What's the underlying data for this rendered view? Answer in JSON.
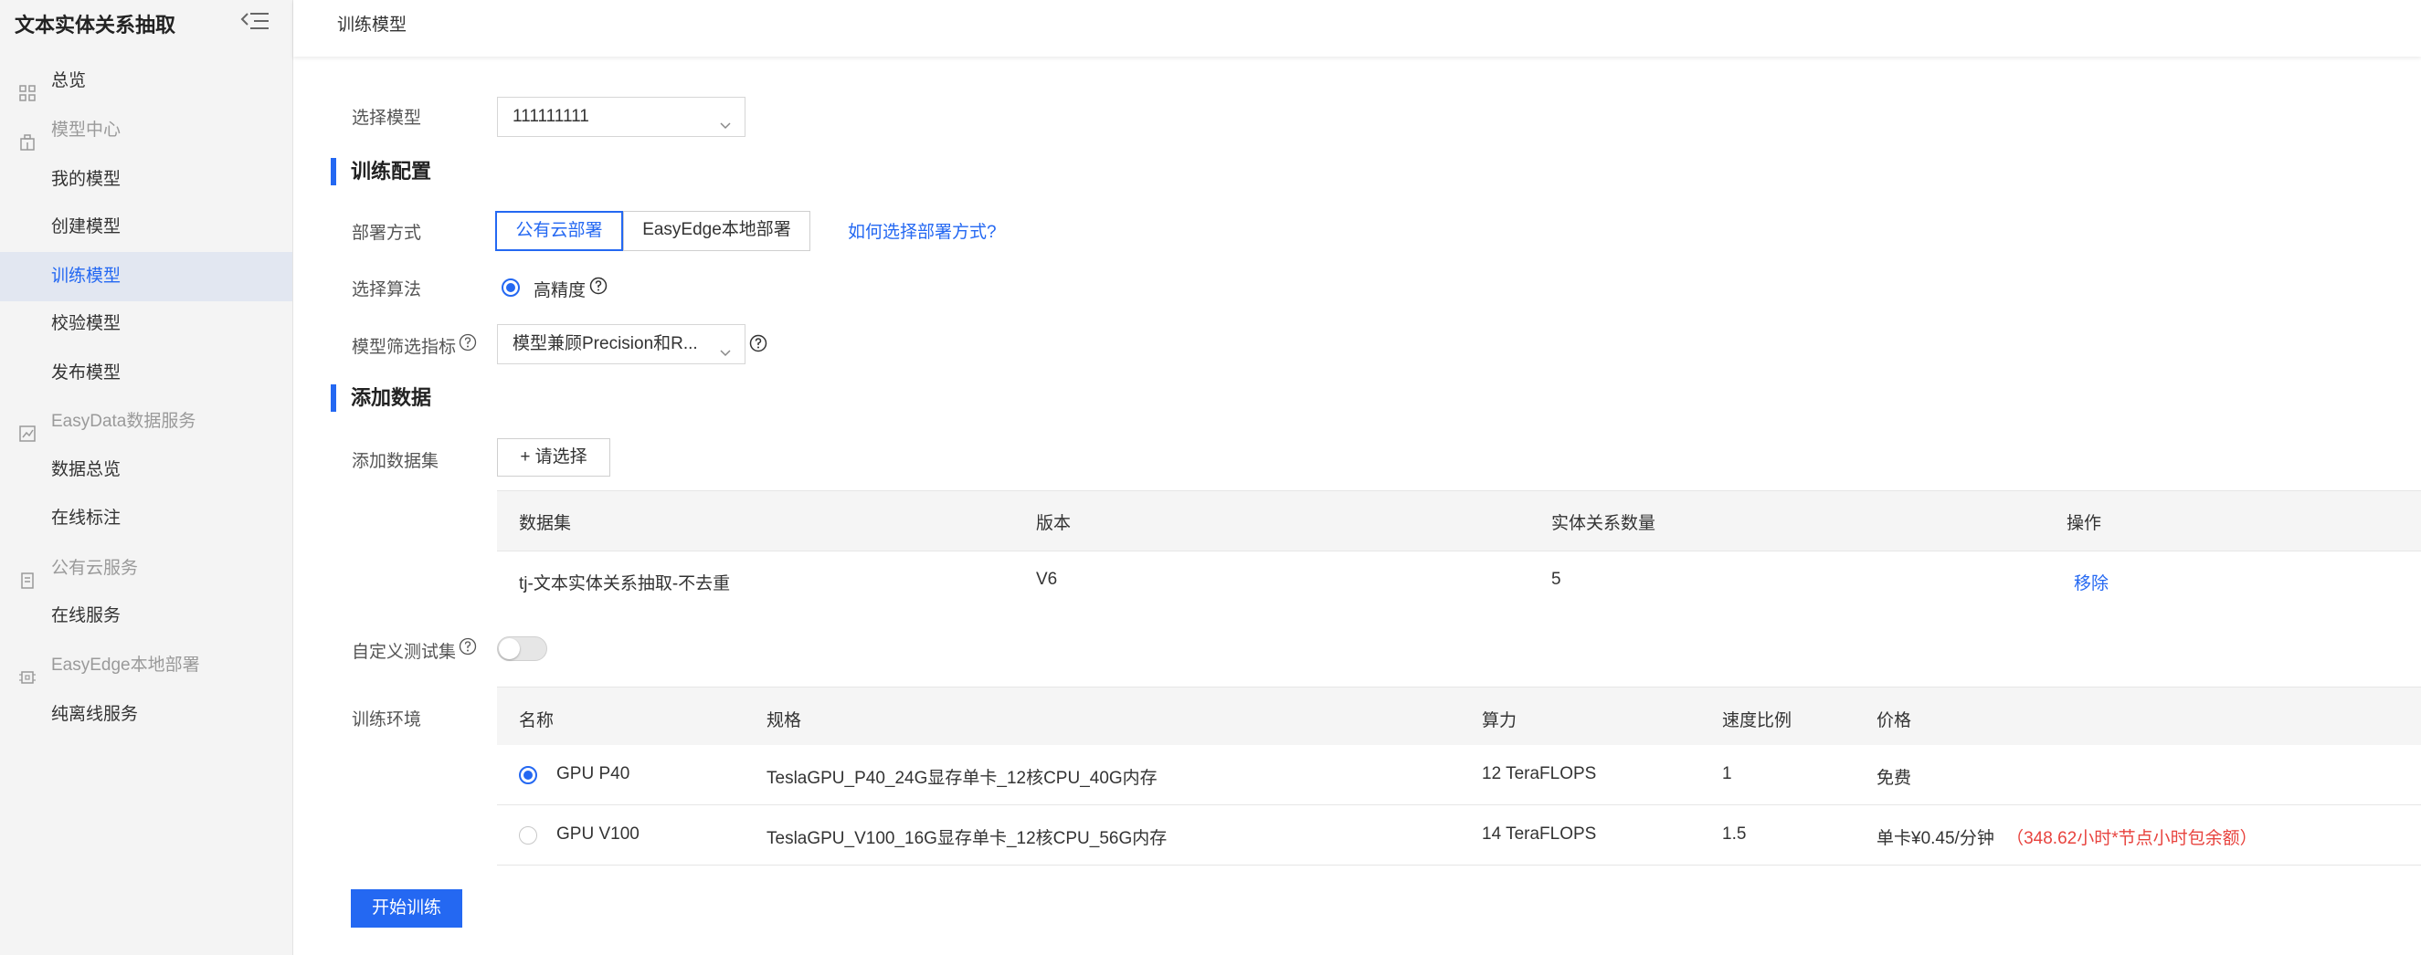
{
  "sidebar": {
    "title": "文本实体关系抽取",
    "items": [
      {
        "label": "总览",
        "type": "item"
      },
      {
        "label": "模型中心",
        "type": "group"
      },
      {
        "label": "我的模型",
        "type": "sub"
      },
      {
        "label": "创建模型",
        "type": "sub"
      },
      {
        "label": "训练模型",
        "type": "sub",
        "active": true
      },
      {
        "label": "校验模型",
        "type": "sub"
      },
      {
        "label": "发布模型",
        "type": "sub"
      },
      {
        "label": "EasyData数据服务",
        "type": "group"
      },
      {
        "label": "数据总览",
        "type": "sub"
      },
      {
        "label": "在线标注",
        "type": "sub"
      },
      {
        "label": "公有云服务",
        "type": "group"
      },
      {
        "label": "在线服务",
        "type": "sub"
      },
      {
        "label": "EasyEdge本地部署",
        "type": "group"
      },
      {
        "label": "纯离线服务",
        "type": "sub"
      }
    ]
  },
  "header": {
    "title": "训练模型"
  },
  "form": {
    "select_model_label": "选择模型",
    "select_model_value": "111111111",
    "section_train_config": "训练配置",
    "deploy_label": "部署方式",
    "deploy_options": [
      "公有云部署",
      "EasyEdge本地部署"
    ],
    "deploy_help_link": "如何选择部署方式?",
    "algo_label": "选择算法",
    "algo_option": "高精度",
    "metric_label": "模型筛选指标",
    "metric_value": "模型兼顾Precision和R...",
    "section_add_data": "添加数据",
    "dataset_label": "添加数据集",
    "add_button": "+ 请选择",
    "custom_test_label": "自定义测试集",
    "env_label": "训练环境",
    "start_button": "开始训练"
  },
  "dataset_table": {
    "headers": [
      "数据集",
      "版本",
      "实体关系数量",
      "操作"
    ],
    "rows": [
      {
        "dataset": "tj-文本实体关系抽取-不去重",
        "version": "V6",
        "count": "5",
        "action": "移除"
      }
    ]
  },
  "env_table": {
    "headers": [
      "名称",
      "规格",
      "算力",
      "速度比例",
      "价格"
    ],
    "rows": [
      {
        "name": "GPU P40",
        "spec": "TeslaGPU_P40_24G显存单卡_12核CPU_40G内存",
        "power": "12 TeraFLOPS",
        "speed": "1",
        "price": "免费",
        "note": "",
        "selected": true
      },
      {
        "name": "GPU V100",
        "spec": "TeslaGPU_V100_16G显存单卡_12核CPU_56G内存",
        "power": "14 TeraFLOPS",
        "speed": "1.5",
        "price": "单卡¥0.45/分钟",
        "note": "（348.62小时*节点小时包余额）",
        "selected": false
      }
    ]
  },
  "colors": {
    "accent": "#2468f2",
    "warning": "#e8433e"
  }
}
